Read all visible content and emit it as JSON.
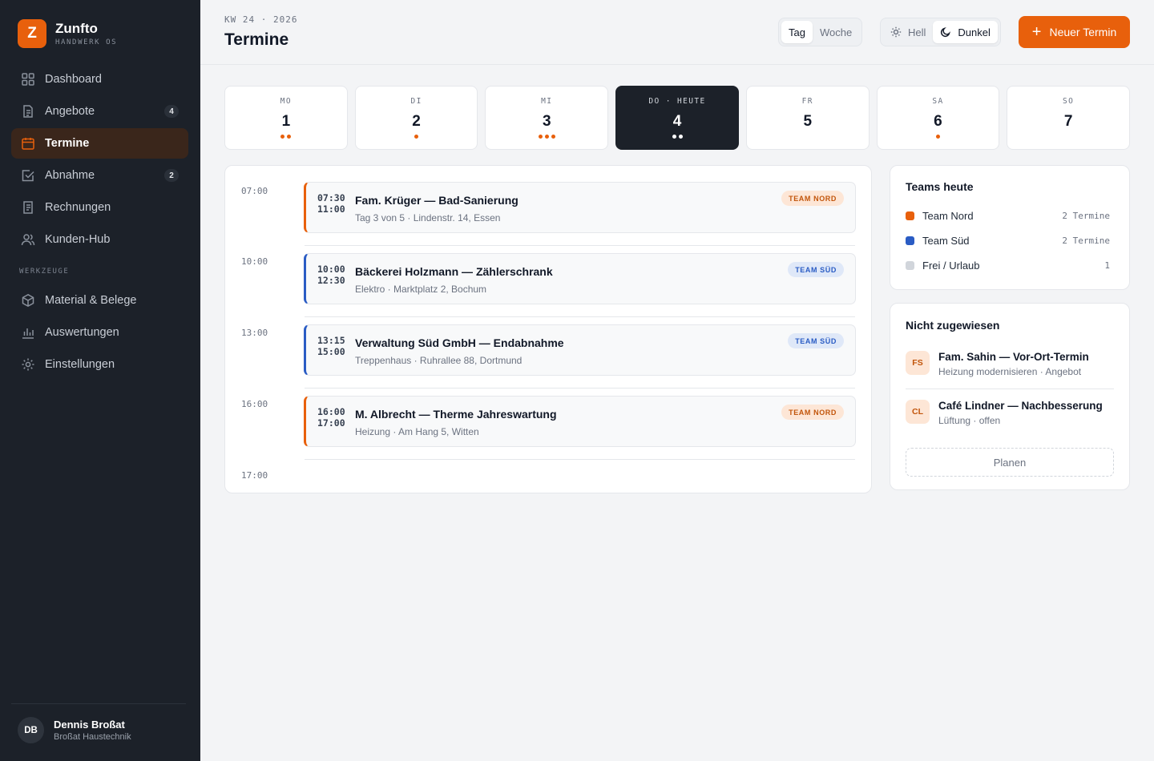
{
  "brand": {
    "logo_letter": "Z",
    "name": "Zunfto",
    "subtitle": "HANDWERK OS",
    "accent": "#e8600c"
  },
  "nav": {
    "items": [
      {
        "label": "Dashboard",
        "icon": "grid-icon"
      },
      {
        "label": "Angebote",
        "icon": "document-icon",
        "badge": "4"
      },
      {
        "label": "Termine",
        "icon": "calendar-icon",
        "active": true
      },
      {
        "label": "Abnahme",
        "icon": "check-square-icon",
        "badge": "2"
      },
      {
        "label": "Rechnungen",
        "icon": "receipt-icon"
      },
      {
        "label": "Kunden-Hub",
        "icon": "users-icon"
      }
    ],
    "section_label": "WERKZEUGE",
    "tools": [
      {
        "label": "Material & Belege",
        "icon": "box-icon"
      },
      {
        "label": "Auswertungen",
        "icon": "bar-chart-icon"
      },
      {
        "label": "Einstellungen",
        "icon": "gear-icon"
      }
    ]
  },
  "user": {
    "initials": "DB",
    "name": "Dennis Broßat",
    "company": "Broßat Haustechnik"
  },
  "header": {
    "week_label": "KW 24 · 2026",
    "title": "Termine",
    "view_toggle": {
      "day": "Tag",
      "week": "Woche",
      "selected": "Tag"
    },
    "theme_toggle": {
      "light": "Hell",
      "dark": "Dunkel",
      "selected": "Dunkel"
    },
    "new_button": "Neuer Termin"
  },
  "week": [
    {
      "name": "MO",
      "num": "1",
      "dots": 2
    },
    {
      "name": "DI",
      "num": "2",
      "dots": 1
    },
    {
      "name": "MI",
      "num": "3",
      "dots": 3
    },
    {
      "name": "DO · HEUTE",
      "num": "4",
      "dots": 2,
      "today": true
    },
    {
      "name": "FR",
      "num": "5",
      "dots": 0
    },
    {
      "name": "SA",
      "num": "6",
      "dots": 1
    },
    {
      "name": "SO",
      "num": "7",
      "dots": 0
    }
  ],
  "schedule": {
    "time_labels": [
      "07:00",
      "10:00",
      "13:00",
      "16:00",
      "17:00"
    ],
    "appointments": [
      {
        "start": "07:30",
        "end": "11:00",
        "title": "Fam. Krüger — Bad-Sanierung",
        "subtitle": "Tag 3 von 5 · Lindenstr. 14, Essen",
        "team_tag": "TEAM NORD",
        "team": "nord"
      },
      {
        "start": "10:00",
        "end": "12:30",
        "title": "Bäckerei Holzmann — Zählerschrank",
        "subtitle": "Elektro · Marktplatz 2, Bochum",
        "team_tag": "TEAM SÜD",
        "team": "sued"
      },
      {
        "start": "13:15",
        "end": "15:00",
        "title": "Verwaltung Süd GmbH — Endabnahme",
        "subtitle": "Treppenhaus · Ruhrallee 88, Dortmund",
        "team_tag": "TEAM SÜD",
        "team": "sued"
      },
      {
        "start": "16:00",
        "end": "17:00",
        "title": "M. Albrecht — Therme Jahreswartung",
        "subtitle": "Heizung · Am Hang 5, Witten",
        "team_tag": "TEAM NORD",
        "team": "nord"
      }
    ]
  },
  "teams_panel": {
    "title": "Teams heute",
    "teams": [
      {
        "name": "Team Nord",
        "count": "2 Termine",
        "color": "#e8600c"
      },
      {
        "name": "Team Süd",
        "count": "2 Termine",
        "color": "#2a5cc4"
      },
      {
        "name": "Frei / Urlaub",
        "count": "1",
        "color": "#d1d5db"
      }
    ]
  },
  "unassigned_panel": {
    "title": "Nicht zugewiesen",
    "items": [
      {
        "initials": "FS",
        "title": "Fam. Sahin — Vor-Ort-Termin",
        "subtitle": "Heizung modernisieren · Angebot"
      },
      {
        "initials": "CL",
        "title": "Café Lindner — Nachbesserung",
        "subtitle": "Lüftung · offen"
      }
    ],
    "plan_button": "Planen"
  }
}
